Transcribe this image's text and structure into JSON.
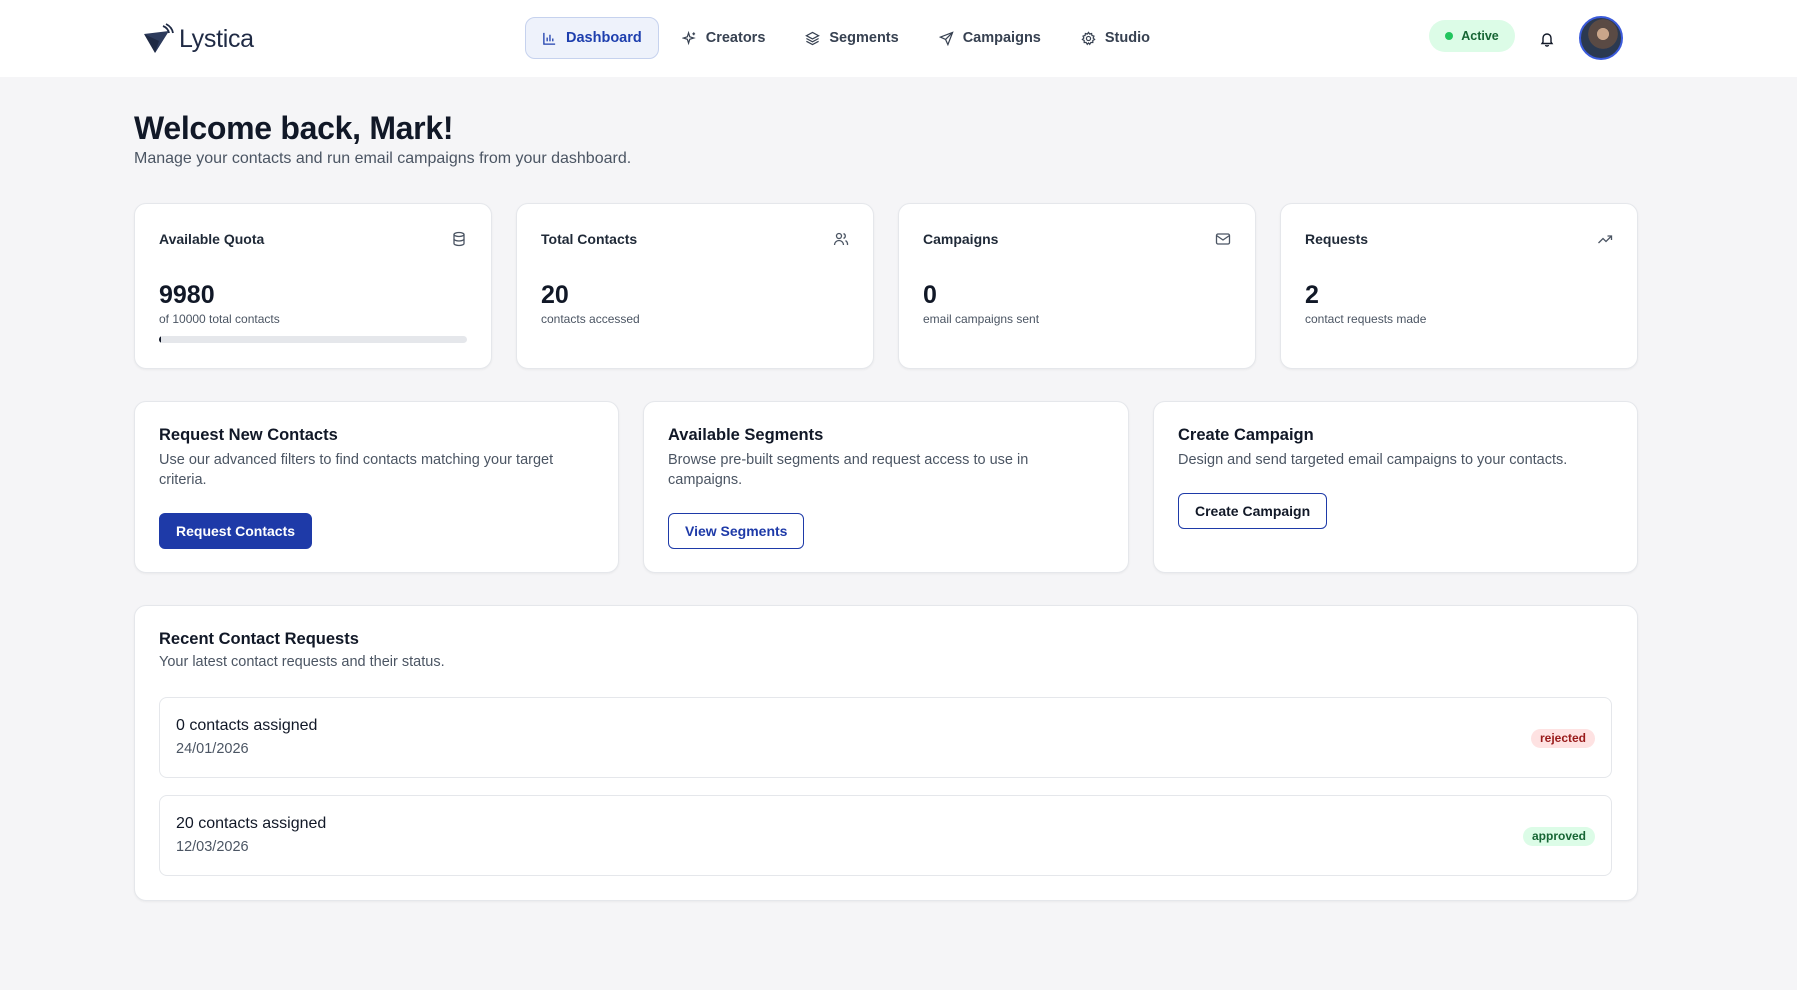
{
  "app": {
    "name": "Lystica"
  },
  "nav": {
    "items": [
      {
        "label": "Dashboard",
        "icon": "bar-chart-icon",
        "active": true
      },
      {
        "label": "Creators",
        "icon": "sparkles-icon",
        "active": false
      },
      {
        "label": "Segments",
        "icon": "layers-icon",
        "active": false
      },
      {
        "label": "Campaigns",
        "icon": "send-icon",
        "active": false
      },
      {
        "label": "Studio",
        "icon": "gear-icon",
        "active": false
      }
    ]
  },
  "header": {
    "status": "Active",
    "bell_icon": "bell-icon",
    "avatar": "user-avatar"
  },
  "page": {
    "title": "Welcome back, Mark!",
    "subtitle": "Manage your contacts and run email campaigns from your dashboard."
  },
  "stats": [
    {
      "title": "Available Quota",
      "icon": "database-icon",
      "value": "9980",
      "caption": "of 10000 total contacts",
      "progress_percent": 0.2
    },
    {
      "title": "Total Contacts",
      "icon": "users-icon",
      "value": "20",
      "caption": "contacts accessed"
    },
    {
      "title": "Campaigns",
      "icon": "mail-icon",
      "value": "0",
      "caption": "email campaigns sent"
    },
    {
      "title": "Requests",
      "icon": "trending-up-icon",
      "value": "2",
      "caption": "contact requests made"
    }
  ],
  "actions": [
    {
      "title": "Request New Contacts",
      "description": "Use our advanced filters to find contacts matching your target criteria.",
      "button": "Request Contacts"
    },
    {
      "title": "Available Segments",
      "description": "Browse pre-built segments and request access to use in campaigns.",
      "button": "View Segments"
    },
    {
      "title": "Create Campaign",
      "description": "Design and send targeted email campaigns to your contacts.",
      "button": "Create Campaign"
    }
  ],
  "recent": {
    "title": "Recent Contact Requests",
    "subtitle": "Your latest contact requests and their status.",
    "items": [
      {
        "label": "0 contacts assigned",
        "date": "24/01/2026",
        "status": "rejected"
      },
      {
        "label": "20 contacts assigned",
        "date": "12/03/2026",
        "status": "approved"
      }
    ]
  },
  "colors": {
    "primary": "#1e3aa8",
    "active_nav_bg": "#eef2fb",
    "status_green": "#22c55e",
    "rejected_bg": "#fee2e2",
    "approved_bg": "#dcfce7"
  }
}
